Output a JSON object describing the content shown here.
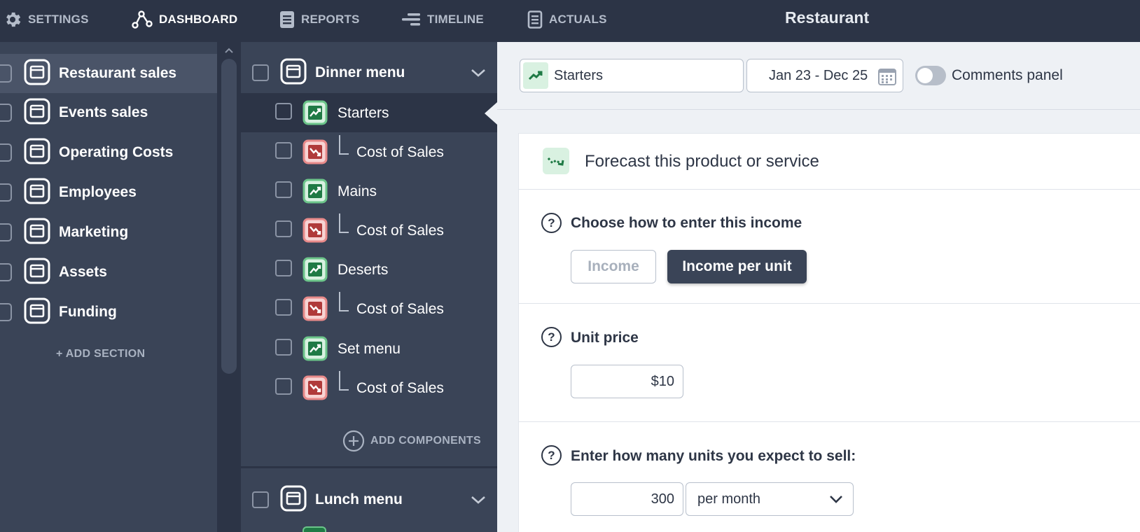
{
  "app_title": "Restaurant",
  "nav": {
    "settings": "SETTINGS",
    "dashboard": "DASHBOARD",
    "reports": "REPORTS",
    "timeline": "TIMELINE",
    "actuals": "ACTUALS",
    "active": "DASHBOARD"
  },
  "sections": {
    "items": [
      {
        "label": "Restaurant sales",
        "active": true
      },
      {
        "label": "Events sales"
      },
      {
        "label": "Operating Costs"
      },
      {
        "label": "Employees"
      },
      {
        "label": "Marketing"
      },
      {
        "label": "Assets"
      },
      {
        "label": "Funding"
      }
    ],
    "add_label": "+ ADD SECTION"
  },
  "components": {
    "group_1": {
      "label": "Dinner menu"
    },
    "items": [
      {
        "label": "Starters",
        "type": "income",
        "active": true
      },
      {
        "label": "Cost of Sales",
        "type": "cost"
      },
      {
        "label": "Mains",
        "type": "income"
      },
      {
        "label": "Cost of Sales",
        "type": "cost"
      },
      {
        "label": "Deserts",
        "type": "income"
      },
      {
        "label": "Cost of Sales",
        "type": "cost"
      },
      {
        "label": "Set menu",
        "type": "income"
      },
      {
        "label": "Cost of Sales",
        "type": "cost"
      }
    ],
    "add_label": "ADD COMPONENTS",
    "group_2": {
      "label": "Lunch menu"
    }
  },
  "filter": {
    "selected_component": "Starters",
    "date_range": "Jan 23 - Dec 25",
    "comments_toggle_label": "Comments panel",
    "comments_enabled": false
  },
  "forecast": {
    "title": "Forecast this product or service",
    "entry_mode": {
      "question": "Choose how to enter this income",
      "options": [
        "Income",
        "Income per unit"
      ],
      "selected": "Income per unit"
    },
    "unit_price": {
      "question": "Unit price",
      "value": "$10"
    },
    "units": {
      "question": "Enter how many units you expect to sell:",
      "value": "300",
      "period": "per month"
    }
  },
  "colors": {
    "nav_bg": "#2c3446",
    "sidebar_bg": "#3a4457",
    "income_green": "#6cc58a",
    "cost_red": "#e88a8a",
    "main_bg": "#eef1f5"
  }
}
